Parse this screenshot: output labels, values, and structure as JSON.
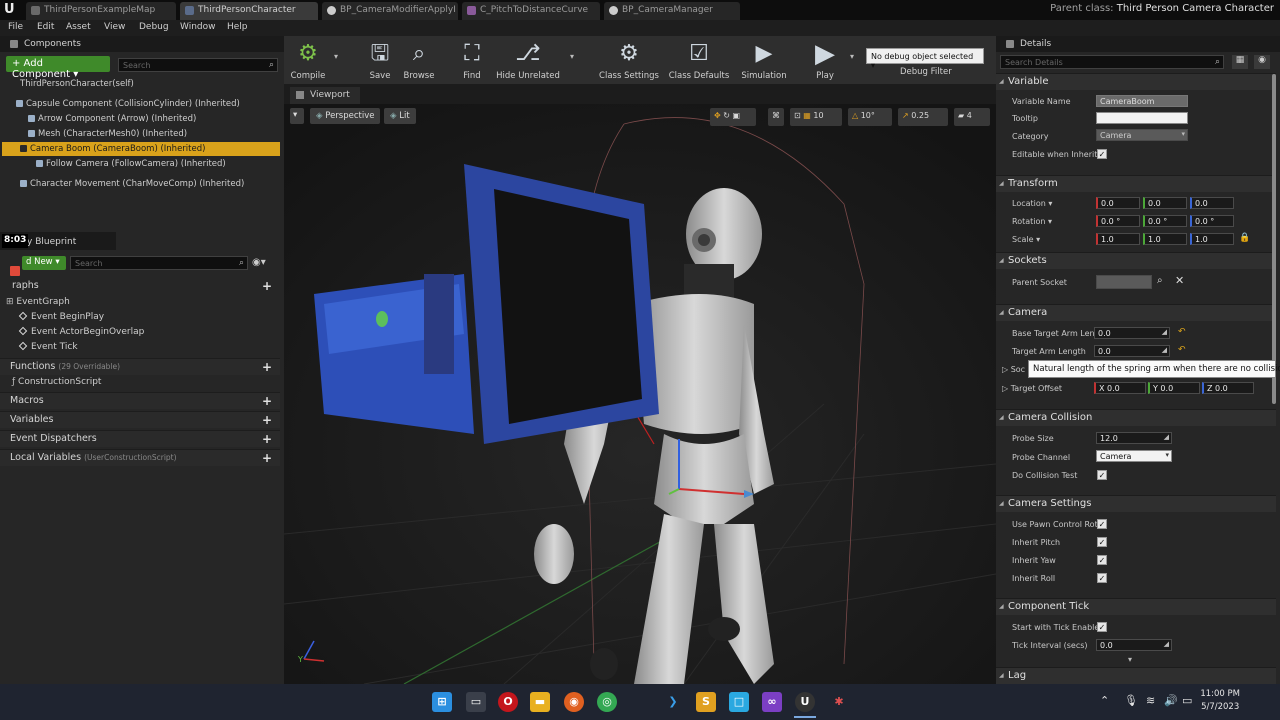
{
  "tabs": [
    {
      "label": "ThirdPersonExampleMap",
      "color": "#6a6a6a"
    },
    {
      "label": "ThirdPersonCharacter",
      "color": "#5a6b8a"
    },
    {
      "label": "BP_CameraModifierApplyI",
      "color": "#cccccc"
    },
    {
      "label": "C_PitchToDistanceCurve",
      "color": "#8a5a9a"
    },
    {
      "label": "BP_CameraManager",
      "color": "#cccccc"
    }
  ],
  "parent_class": {
    "label": "Parent class:",
    "value": "Third Person Camera Character"
  },
  "menu": [
    "File",
    "Edit",
    "Asset",
    "View",
    "Debug",
    "Window",
    "Help"
  ],
  "components": {
    "header": "Components",
    "add_label": "+ Add Component ▾",
    "search_placeholder": "Search",
    "self": "ThirdPersonCharacter(self)",
    "items": [
      "Capsule Component (CollisionCylinder) (Inherited)",
      "Arrow Component (Arrow) (Inherited)",
      "Mesh (CharacterMesh0) (Inherited)",
      "Camera Boom (CameraBoom) (Inherited)",
      "Follow Camera (FollowCamera) (Inherited)",
      "Character Movement (CharMoveComp) (Inherited)"
    ]
  },
  "my_blueprint": {
    "header": "fy Blueprint",
    "timer": "8:03",
    "add_new": "d New ▾",
    "search_placeholder": "Search",
    "graphs": "raphs",
    "event_graph": "EventGraph",
    "events": [
      "Event BeginPlay",
      "Event ActorBeginOverlap",
      "Event Tick"
    ],
    "functions": "Functions",
    "functions_count": "(29 Overridable)",
    "construction": "ConstructionScript",
    "macros": "Macros",
    "variables": "Variables",
    "dispatchers": "Event Dispatchers",
    "local_vars": "Local Variables",
    "local_vars_scope": "(UserConstructionScript)"
  },
  "toolbar": {
    "compile": "Compile",
    "save": "Save",
    "browse": "Browse",
    "find": "Find",
    "hide_unrelated": "Hide Unrelated",
    "class_settings": "Class Settings",
    "class_defaults": "Class Defaults",
    "simulation": "Simulation",
    "play": "Play",
    "debug_object": "No debug object selected ▾",
    "debug_filter": "Debug Filter"
  },
  "viewport": {
    "tab": "Viewport",
    "perspective": "Perspective",
    "lit": "Lit",
    "grid_snap": "10",
    "rot_snap": "10°",
    "scale_snap": "0.25",
    "cam_speed": "4"
  },
  "details": {
    "header": "Details",
    "search_placeholder": "Search Details",
    "variable": {
      "title": "Variable",
      "name_label": "Variable Name",
      "name_value": "CameraBoom",
      "tooltip_label": "Tooltip",
      "category_label": "Category",
      "category_value": "Camera",
      "editable_label": "Editable when Inherite"
    },
    "transform": {
      "title": "Transform",
      "location_label": "Location ▾",
      "rotation_label": "Rotation ▾",
      "scale_label": "Scale ▾",
      "location": [
        "0.0",
        "0.0",
        "0.0"
      ],
      "rotation": [
        "0.0 °",
        "0.0 °",
        "0.0 °"
      ],
      "scale": [
        "1.0",
        "1.0",
        "1.0"
      ]
    },
    "sockets": {
      "title": "Sockets",
      "parent_label": "Parent Socket"
    },
    "camera": {
      "title": "Camera",
      "base_arm_label": "Base Target Arm Lengt",
      "base_arm_value": "0.0",
      "arm_label": "Target Arm Length",
      "arm_value": "0.0",
      "socket_offset_label": "Soc",
      "target_offset_label": "Target Offset",
      "target_offset": [
        "X 0.0",
        "Y 0.0",
        "Z 0.0"
      ]
    },
    "tooltip": "Natural length of the spring arm when there are no collisions",
    "collision": {
      "title": "Camera Collision",
      "probe_size_label": "Probe Size",
      "probe_size_value": "12.0",
      "probe_channel_label": "Probe Channel",
      "probe_channel_value": "Camera",
      "do_test_label": "Do Collision Test"
    },
    "settings": {
      "title": "Camera Settings",
      "use_pawn_label": "Use Pawn Control Rota",
      "pitch_label": "Inherit Pitch",
      "yaw_label": "Inherit Yaw",
      "roll_label": "Inherit Roll"
    },
    "tick": {
      "title": "Component Tick",
      "start_label": "Start with Tick Enabled",
      "interval_label": "Tick Interval (secs)",
      "interval_value": "0.0"
    },
    "lag": {
      "title": "Lag"
    }
  },
  "taskbar": {
    "time": "11:00 PM",
    "date": "5/7/2023"
  }
}
